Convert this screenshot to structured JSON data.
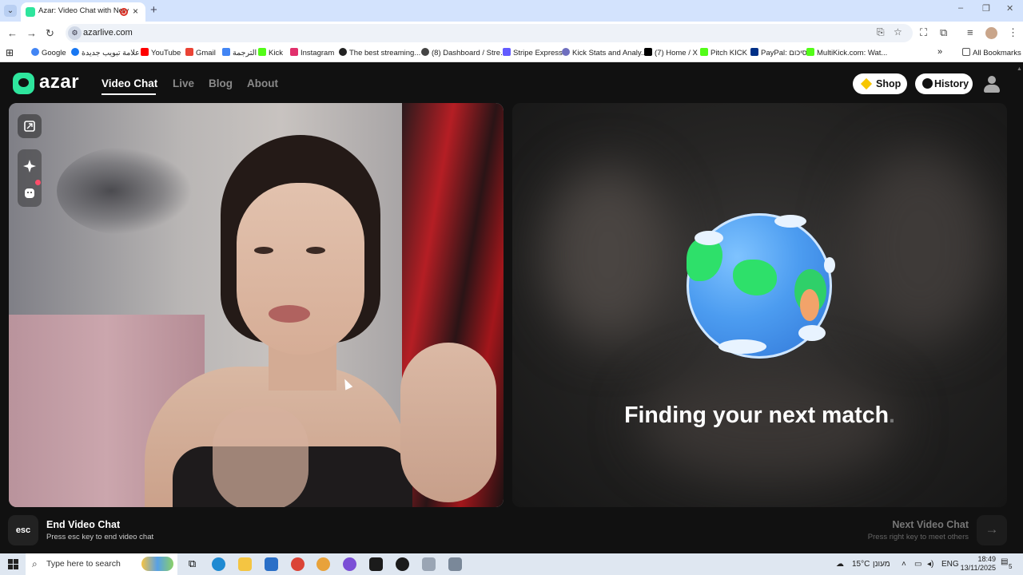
{
  "browser": {
    "tab_title": "Azar: Video Chat with New",
    "new_tab": "+",
    "url": "azarlive.com",
    "window_controls": [
      "–",
      "❐",
      "✕"
    ],
    "bookmarks": [
      {
        "label": "Google",
        "color": "#4285f4"
      },
      {
        "label": "علامة تبويب جديدة",
        "color": "#1877f2"
      },
      {
        "label": "YouTube",
        "color": "#ff0000"
      },
      {
        "label": "Gmail",
        "color": "#ea4335"
      },
      {
        "label": "الترجمة",
        "color": "#4285f4"
      },
      {
        "label": "Kick",
        "color": "#53fc18"
      },
      {
        "label": "Instagram",
        "color": "#e1306c"
      },
      {
        "label": "The best streaming...",
        "color": "#222222"
      },
      {
        "label": "(8) Dashboard / Stre...",
        "color": "#444444"
      },
      {
        "label": "Stripe Express",
        "color": "#635bff"
      },
      {
        "label": "Kick Stats and Analy...",
        "color": "#6f6fbf"
      },
      {
        "label": "(7) Home / X",
        "color": "#000000"
      },
      {
        "label": "Pitch KICK",
        "color": "#53fc18"
      },
      {
        "label": "PayPal: סיכום",
        "color": "#003087"
      },
      {
        "label": "MultiKick.com: Wat...",
        "color": "#53fc18"
      }
    ],
    "more_bookmarks": "»",
    "all_bookmarks": "All Bookmarks"
  },
  "site": {
    "logo": "azar",
    "nav": [
      "Video Chat",
      "Live",
      "Blog",
      "About"
    ],
    "shop_label": "Shop",
    "history_label": "History",
    "finding_text": "Finding your next match",
    "finding_dots": ".",
    "esc_key": "esc",
    "end_title": "End Video Chat",
    "end_subtitle": "Press esc key to end video chat",
    "next_title": "Next Video Chat",
    "next_subtitle": "Press right key to meet others",
    "next_arrow": "→",
    "accent_color": "#2ee59d"
  },
  "taskbar": {
    "search_placeholder": "Type here to search",
    "temperature": "15°C",
    "weather": "מעונן",
    "language": "ENG",
    "time": "18:49",
    "date": "13/11/2025",
    "notifications": "5"
  }
}
